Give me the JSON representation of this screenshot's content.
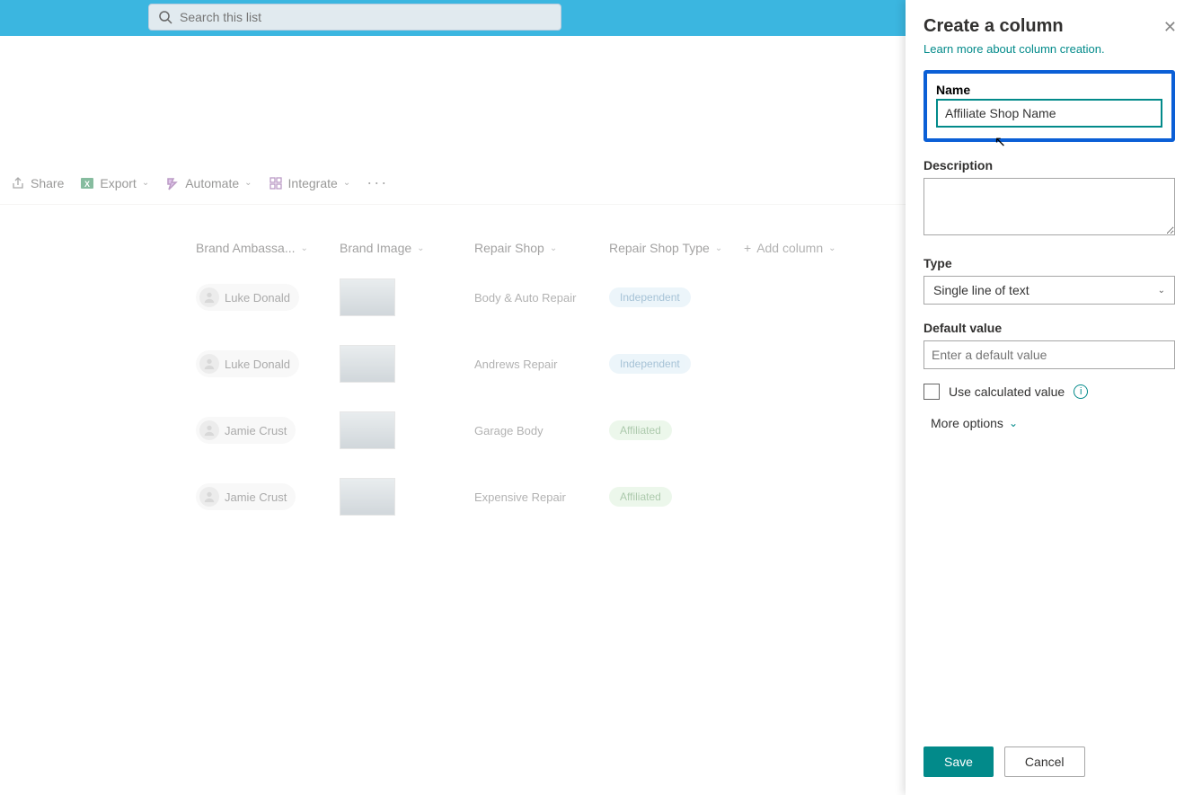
{
  "search": {
    "placeholder": "Search this list"
  },
  "commands": {
    "share": "Share",
    "export": "Export",
    "automate": "Automate",
    "integrate": "Integrate"
  },
  "columns": {
    "brand_ambassador": "Brand Ambassa...",
    "brand_image": "Brand Image",
    "repair_shop": "Repair Shop",
    "repair_shop_type": "Repair Shop Type",
    "add_column": "Add column"
  },
  "rows": [
    {
      "ambassador": "Luke Donald",
      "shop": "Body & Auto Repair",
      "type": "Independent",
      "type_class": "ind"
    },
    {
      "ambassador": "Luke Donald",
      "shop": "Andrews Repair",
      "type": "Independent",
      "type_class": "ind"
    },
    {
      "ambassador": "Jamie Crust",
      "shop": "Garage Body",
      "type": "Affiliated",
      "type_class": "aff"
    },
    {
      "ambassador": "Jamie Crust",
      "shop": "Expensive Repair",
      "type": "Affiliated",
      "type_class": "aff"
    }
  ],
  "panel": {
    "title": "Create a column",
    "learn_more": "Learn more about column creation.",
    "name_label": "Name",
    "name_value": "Affiliate Shop Name",
    "description_label": "Description",
    "type_label": "Type",
    "type_value": "Single line of text",
    "default_label": "Default value",
    "default_placeholder": "Enter a default value",
    "calc_label": "Use calculated value",
    "more_options": "More options",
    "save": "Save",
    "cancel": "Cancel"
  }
}
